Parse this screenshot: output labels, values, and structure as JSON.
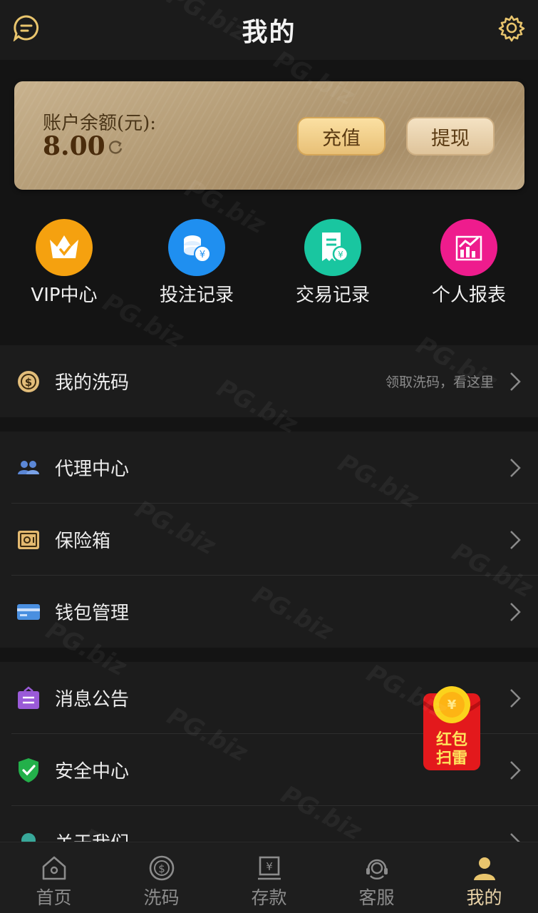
{
  "header": {
    "title": "我的",
    "chat_icon": "chat-bubble-icon",
    "settings_icon": "gear-icon"
  },
  "balance": {
    "label": "账户余额(元):",
    "value": "8.00",
    "recharge_label": "充值",
    "withdraw_label": "提现"
  },
  "quick_menu": [
    {
      "label": "VIP中心",
      "icon": "crown-icon",
      "color": "#f5a10f"
    },
    {
      "label": "投注记录",
      "icon": "coins-icon",
      "color": "#1f8ff0"
    },
    {
      "label": "交易记录",
      "icon": "receipt-icon",
      "color": "#19c6a0"
    },
    {
      "label": "个人报表",
      "icon": "chart-icon",
      "color": "#ee1c8d"
    }
  ],
  "menu": {
    "wash": {
      "label": "我的洗码",
      "hint": "领取洗码，看这里"
    },
    "agent": {
      "label": "代理中心"
    },
    "safe": {
      "label": "保险箱"
    },
    "wallet": {
      "label": "钱包管理"
    },
    "notice": {
      "label": "消息公告"
    },
    "security": {
      "label": "安全中心"
    },
    "about": {
      "label": "关于我们"
    }
  },
  "red_packet": {
    "line1": "红包",
    "line2": "扫雷"
  },
  "tabs": [
    {
      "label": "首页",
      "icon": "home-icon"
    },
    {
      "label": "洗码",
      "icon": "dollar-coin-icon"
    },
    {
      "label": "存款",
      "icon": "deposit-icon"
    },
    {
      "label": "客服",
      "icon": "headset-icon"
    },
    {
      "label": "我的",
      "icon": "user-icon",
      "active": true
    }
  ],
  "watermark": "PG.biz",
  "colors": {
    "accent_gold": "#e9d3a8",
    "background": "#141414",
    "row_background": "#1c1c1c"
  }
}
